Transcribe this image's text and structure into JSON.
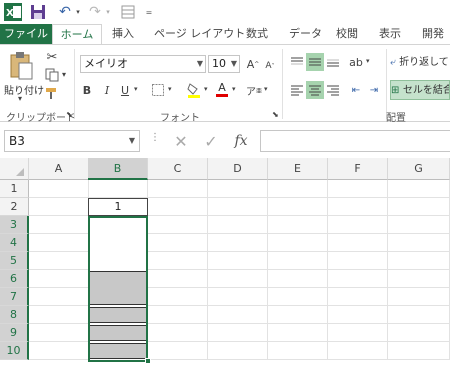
{
  "qat": {
    "app_icon": "excel-icon",
    "icons": [
      "save-icon",
      "undo-icon",
      "redo-icon",
      "form-icon",
      "customize-icon"
    ]
  },
  "tabs": [
    "ファイル",
    "ホーム",
    "挿入",
    "ページ レイアウト",
    "数式",
    "データ",
    "校閲",
    "表示",
    "開発"
  ],
  "ribbon": {
    "paste_label": "貼り付け",
    "clipboard_group": "クリップボード",
    "font_group": "フォント",
    "alignment_group": "配置",
    "font_name": "メイリオ",
    "font_size": "10",
    "wrap_text_label": "折り返して",
    "merge_label": "セルを結合"
  },
  "formula_bar": {
    "name_box": "B3",
    "fx_label": "fx",
    "value": ""
  },
  "grid": {
    "columns": [
      "A",
      "B",
      "C",
      "D",
      "E",
      "F",
      "G"
    ],
    "rows": [
      "1",
      "2",
      "3",
      "4",
      "5",
      "6",
      "7",
      "8",
      "9",
      "10"
    ],
    "b2_value": "1",
    "selected_cell": "B3",
    "selection_range": "B3:B10"
  },
  "colors": {
    "accent": "#217346",
    "fill_gray": "#c8c8c8"
  }
}
